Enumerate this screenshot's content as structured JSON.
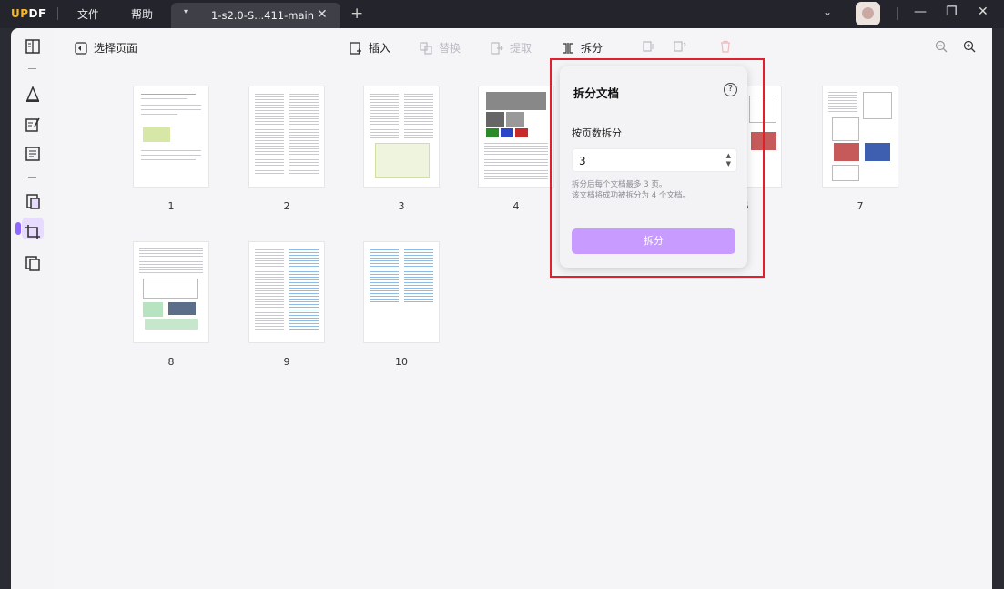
{
  "titlebar": {
    "logo": "UPDF",
    "menu": [
      "文件",
      "帮助"
    ],
    "tab_title": "1-s2.0-S...411-main"
  },
  "toolbar": {
    "select_pages": "选择页面",
    "insert": "插入",
    "replace": "替换",
    "extract": "提取",
    "split": "拆分"
  },
  "pages": [
    "1",
    "2",
    "3",
    "4",
    "6",
    "7",
    "8",
    "9",
    "10"
  ],
  "split_dialog": {
    "title": "拆分文档",
    "help": "?",
    "mode_label": "按页数拆分",
    "input_value": "3",
    "hint_line1": "拆分后每个文档最多 3 页。",
    "hint_line2": "该文档将成功被拆分为 4 个文档。",
    "button": "拆分"
  },
  "colors": {
    "accent": "#8f68ff",
    "button": "#c79bff",
    "highlight_box": "#e0202d"
  }
}
